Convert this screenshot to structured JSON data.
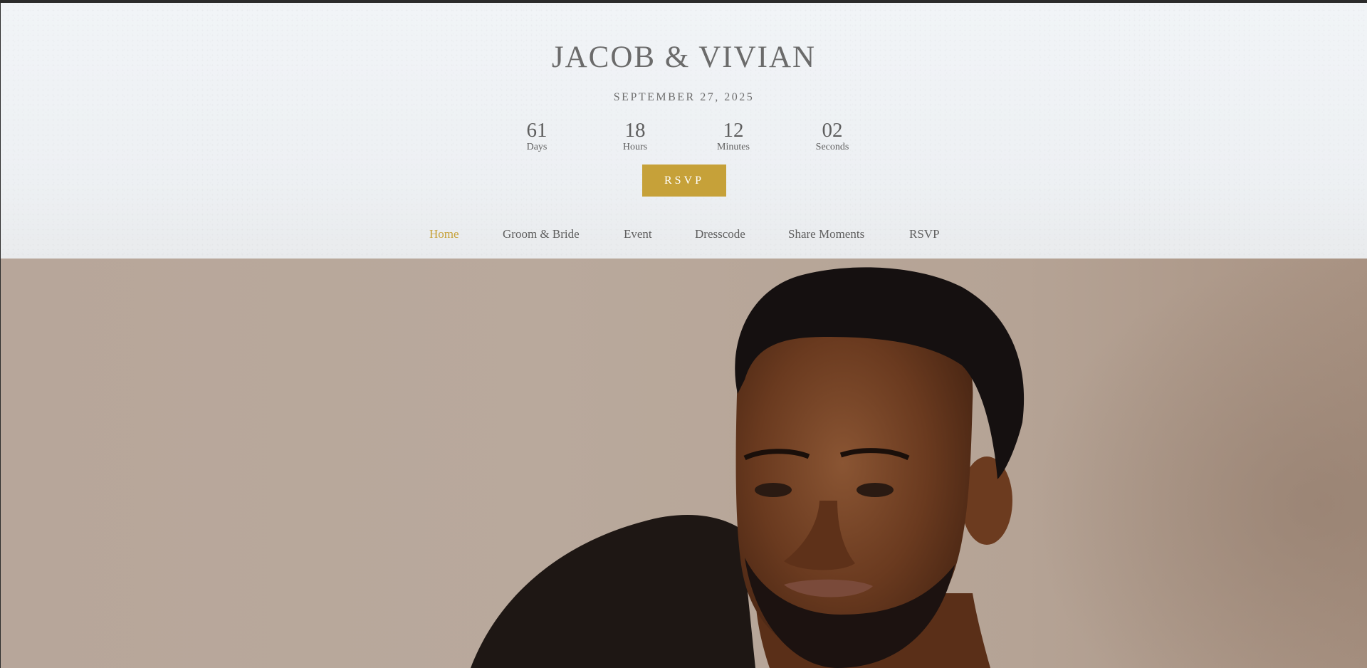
{
  "header": {
    "title": "JACOB & VIVIAN",
    "date": "SEPTEMBER 27, 2025"
  },
  "countdown": {
    "days": {
      "value": "61",
      "label": "Days"
    },
    "hours": {
      "value": "18",
      "label": "Hours"
    },
    "minutes": {
      "value": "12",
      "label": "Minutes"
    },
    "seconds": {
      "value": "02",
      "label": "Seconds"
    }
  },
  "rsvp_button": {
    "label": "RSVP"
  },
  "nav": {
    "items": [
      {
        "label": "Home",
        "active": true
      },
      {
        "label": "Groom & Bride"
      },
      {
        "label": "Event"
      },
      {
        "label": "Dresscode"
      },
      {
        "label": "Share Moments"
      },
      {
        "label": "RSVP"
      }
    ]
  },
  "colors": {
    "accent": "#c6a139",
    "text": "#6b6b6b",
    "header_bg": "#eff2f5",
    "hero_bg": "#b7a69a"
  }
}
